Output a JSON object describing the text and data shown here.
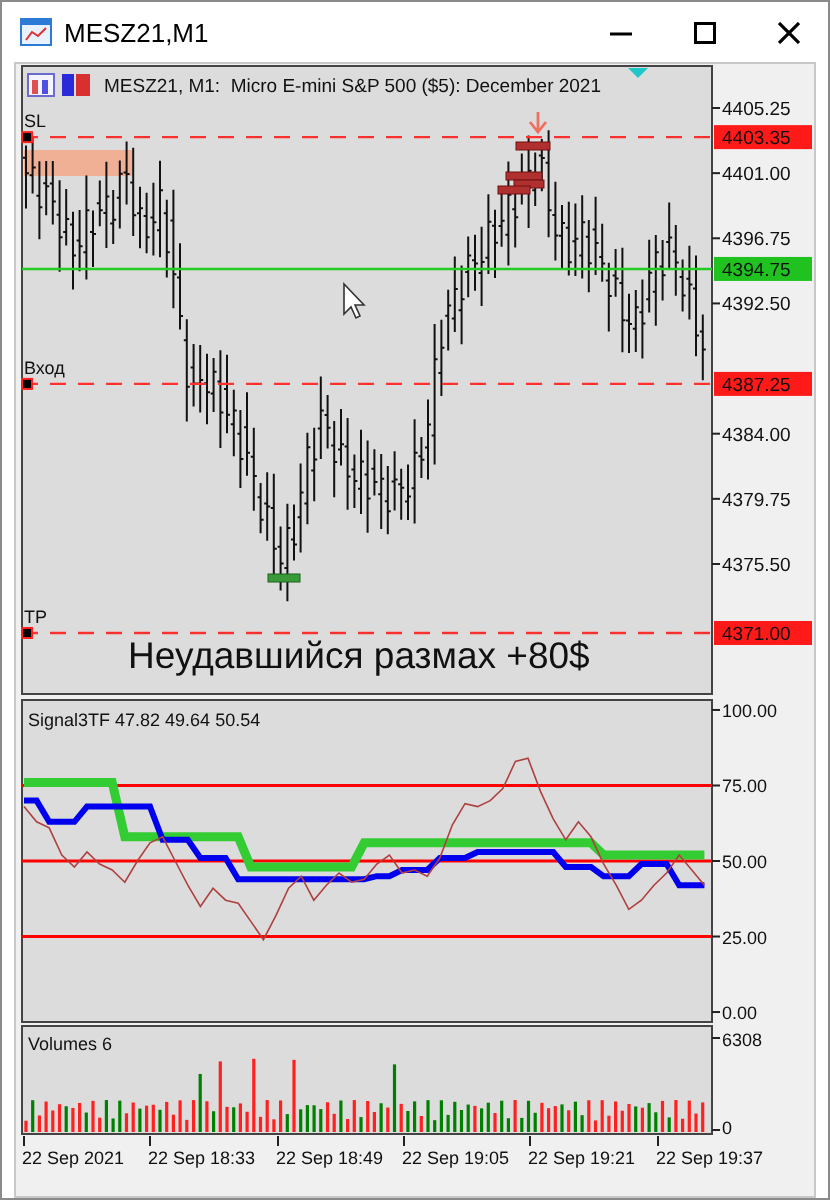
{
  "window": {
    "title": "MESZ21,M1"
  },
  "chart": {
    "header": "MESZ21, M1:  Micro E-mini S&P 500 ($5): December 2021",
    "price_ticks": [
      "4405.25",
      "4401.00",
      "4396.75",
      "4392.50",
      "4384.00",
      "4379.75",
      "4375.50"
    ],
    "levels": [
      {
        "label": "SL",
        "price": "4403.35",
        "kind": "stop"
      },
      {
        "price": "4394.75",
        "kind": "bid"
      },
      {
        "label": "Вход",
        "price": "4387.25",
        "kind": "entry"
      },
      {
        "label": "TP",
        "price": "4371.00",
        "kind": "target"
      }
    ],
    "caption": "Неудавшийся размах +80$"
  },
  "indicator": {
    "header": "Signal3TF 47.82 49.64 50.54",
    "chart_data": {
      "type": "line",
      "ylim": [
        -3.3,
        103.3
      ],
      "grid": true,
      "yticks": [
        {
          "value": 100,
          "label": "100.00"
        },
        {
          "value": 75,
          "label": "75.00"
        },
        {
          "value": 50,
          "label": "50.00"
        },
        {
          "value": 25,
          "label": "25.00"
        },
        {
          "value": 0,
          "label": "0.00"
        }
      ],
      "series": [
        {
          "color": "#33cc33",
          "values": [
            76,
            76,
            76,
            76,
            76,
            76,
            76,
            76,
            58,
            58,
            58,
            58,
            58,
            58,
            58,
            58,
            58,
            58,
            48,
            48,
            48,
            48,
            48,
            48,
            48,
            48,
            48,
            56,
            56,
            56,
            56,
            56,
            56,
            56,
            56,
            56,
            56,
            56,
            56,
            56,
            56,
            56,
            56,
            56,
            56,
            56,
            52,
            52,
            52,
            52,
            52,
            52,
            52,
            52,
            52
          ]
        },
        {
          "color": "#0000ee",
          "values": [
            70,
            70,
            63,
            63,
            63,
            68,
            68,
            68,
            68,
            68,
            68,
            57,
            57,
            57,
            51,
            51,
            51,
            44,
            44,
            44,
            44,
            44,
            44,
            44,
            44,
            44,
            44,
            44,
            45,
            45,
            47,
            47,
            47,
            51,
            51,
            51,
            53,
            53,
            53,
            53,
            53,
            53,
            53,
            48,
            48,
            48,
            45,
            45,
            45,
            49,
            49,
            49,
            42,
            42,
            42
          ]
        },
        {
          "color": "#b04040",
          "values": [
            68,
            63,
            61,
            52,
            48,
            53,
            49,
            47,
            43,
            50,
            56,
            58,
            50,
            42,
            35,
            41,
            37,
            36,
            30,
            24,
            32,
            41,
            45,
            37,
            42,
            46,
            43,
            44,
            49,
            52,
            46,
            47,
            45,
            51,
            62,
            69,
            68,
            70,
            74,
            83,
            84,
            73,
            64,
            57,
            63,
            58,
            49,
            42,
            34,
            37,
            42,
            46,
            52,
            47,
            42
          ]
        }
      ]
    }
  },
  "volumes": {
    "header": "Volumes 6",
    "ticks": [
      "6308",
      "0"
    ]
  },
  "time_axis": [
    "22 Sep 2021",
    "22 Sep 18:33",
    "22 Sep 18:49",
    "22 Sep 19:05",
    "22 Sep 19:21",
    "22 Sep 19:37"
  ]
}
